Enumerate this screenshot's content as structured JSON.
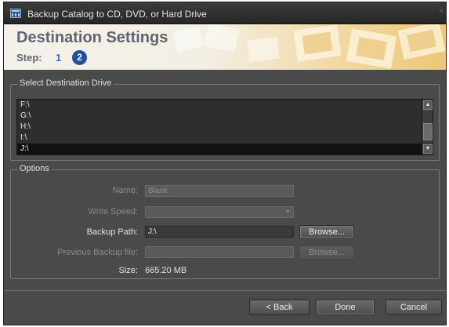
{
  "window": {
    "title": "Backup Catalog to CD, DVD, or Hard Drive",
    "close": "×"
  },
  "header": {
    "title": "Destination Settings",
    "step_label": "Step:",
    "steps": [
      "1",
      "2"
    ],
    "current_step": "2"
  },
  "destination": {
    "group_title": "Select Destination Drive",
    "drives": [
      "F:\\",
      "G:\\",
      "H:\\",
      "I:\\",
      "J:\\"
    ],
    "selected": "J:\\",
    "scroll_up": "▲",
    "scroll_down": "▼"
  },
  "options": {
    "group_title": "Options",
    "name_label": "Name:",
    "name_value": "Blank",
    "write_speed_label": "Write Speed:",
    "write_speed_value": "",
    "backup_path_label": "Backup Path:",
    "backup_path_value": "J:\\",
    "browse_label": "Browse...",
    "previous_backup_label": "Previous Backup file:",
    "previous_backup_value": "",
    "previous_browse_label": "Browse...",
    "size_label": "Size:",
    "size_value": "665.20 MB"
  },
  "footer": {
    "back": "< Back",
    "done": "Done",
    "cancel": "Cancel"
  },
  "colors": {
    "dialog_bg": "#4a4a4a",
    "selection": "#111111",
    "step_badge": "#254f9d",
    "step_text": "#3f6fb0"
  }
}
